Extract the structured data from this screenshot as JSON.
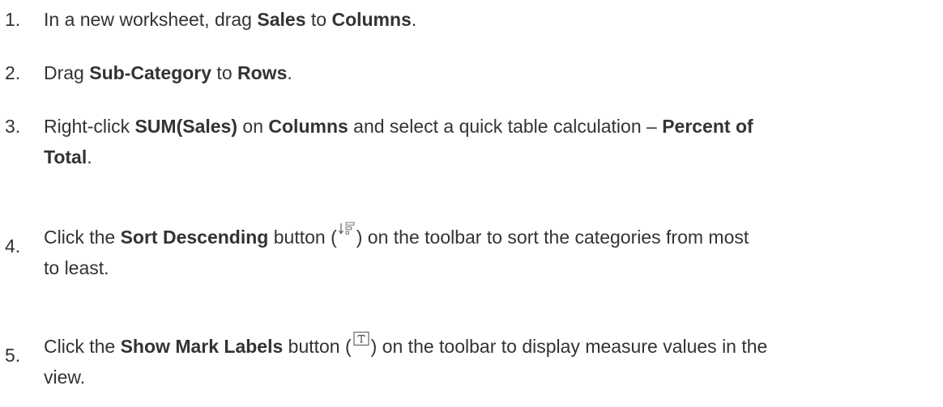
{
  "steps": [
    {
      "number": "1.",
      "parts": [
        "In a new worksheet, drag ",
        "Sales",
        " to ",
        "Columns",
        "."
      ]
    },
    {
      "number": "2.",
      "parts": [
        "Drag ",
        "Sub-Category",
        " to ",
        "Rows",
        "."
      ]
    },
    {
      "number": "3.",
      "parts": [
        "Right-click ",
        "SUM(Sales)",
        " on ",
        "Columns",
        " and select a quick table calculation – ",
        "Percent of",
        "Total",
        "."
      ]
    },
    {
      "number": "4.",
      "parts": [
        "Click the ",
        "Sort Descending",
        " button (",
        ") on the toolbar to sort the categories from most",
        "to least."
      ],
      "icon": "sort-descending-icon"
    },
    {
      "number": "5.",
      "parts": [
        "Click the ",
        "Show Mark Labels",
        " button (",
        ") on the toolbar to display measure values in the",
        "view."
      ],
      "icon": "show-mark-labels-icon"
    }
  ]
}
